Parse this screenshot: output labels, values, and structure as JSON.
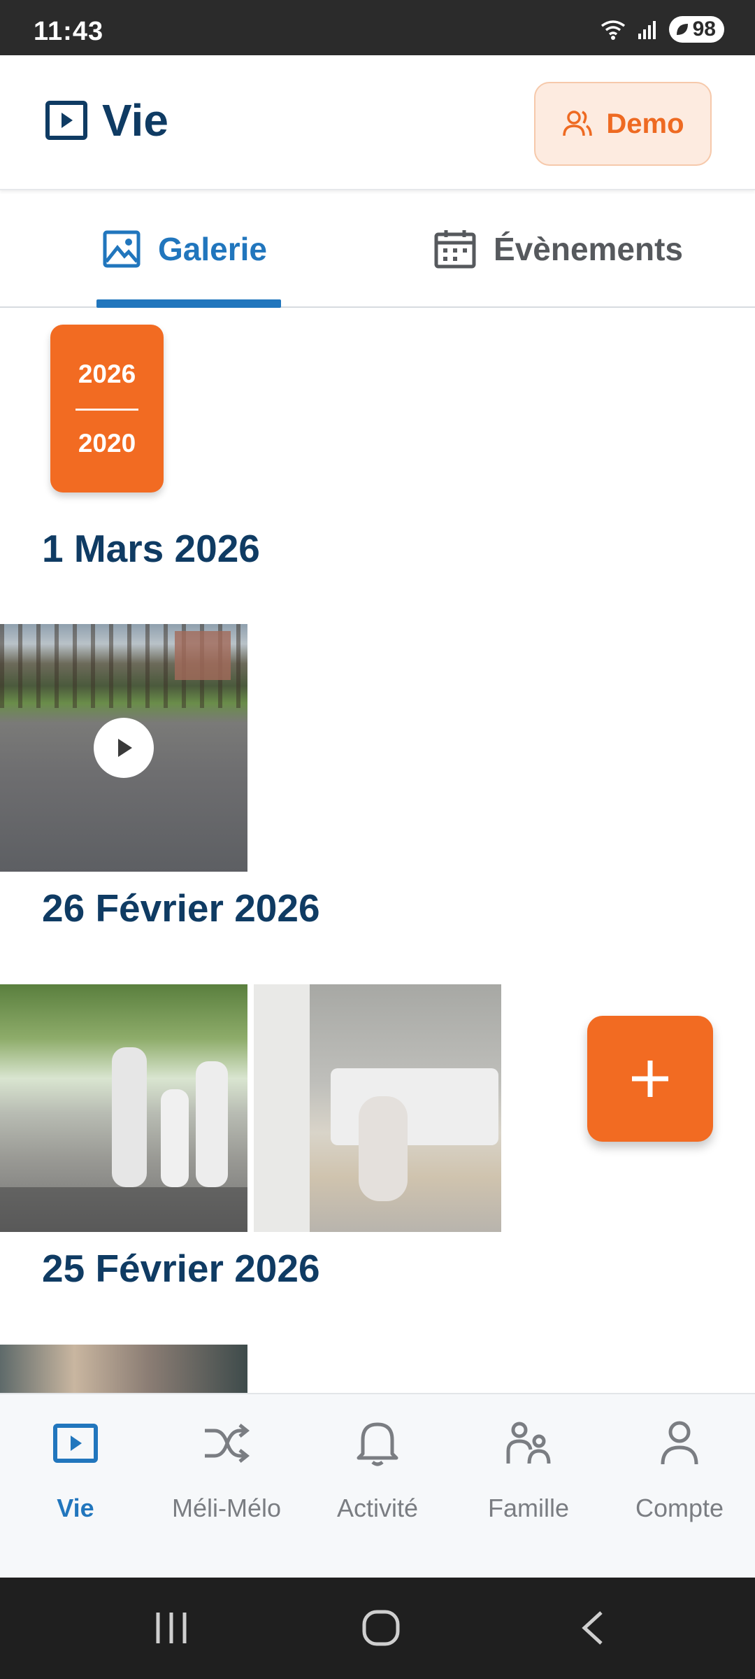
{
  "status_bar": {
    "time": "11:43",
    "battery": "98"
  },
  "header": {
    "title": "Vie",
    "demo_label": "Demo"
  },
  "tabs": [
    {
      "label": "Galerie",
      "active": true
    },
    {
      "label": "Évènements",
      "active": false
    }
  ],
  "year_range": {
    "from": "2026",
    "to": "2020"
  },
  "gallery": [
    {
      "date": "1 Mars 2026",
      "items": [
        {
          "type": "video"
        }
      ]
    },
    {
      "date": "26 Février 2026",
      "items": [
        {
          "type": "photo"
        },
        {
          "type": "photo"
        }
      ]
    },
    {
      "date": "25 Février 2026",
      "items": [
        {
          "type": "photo"
        }
      ]
    }
  ],
  "bottom_nav": [
    {
      "label": "Vie",
      "icon": "play-square-icon",
      "active": true
    },
    {
      "label": "Méli-Mélo",
      "icon": "shuffle-icon",
      "active": false
    },
    {
      "label": "Activité",
      "icon": "bell-icon",
      "active": false
    },
    {
      "label": "Famille",
      "icon": "family-icon",
      "active": false
    },
    {
      "label": "Compte",
      "icon": "user-icon",
      "active": false
    }
  ],
  "colors": {
    "accent": "#f26b22",
    "primary": "#2176bd",
    "title": "#0f3b63"
  }
}
